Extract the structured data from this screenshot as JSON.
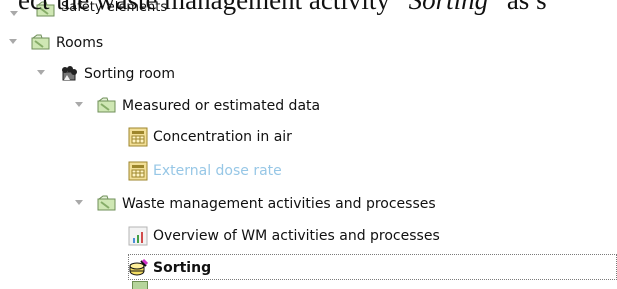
{
  "document": {
    "top_text_prefix": "ect the waste management activity “",
    "top_text_italic": "Sorting",
    "top_text_suffix": "” as s"
  },
  "tree": {
    "items": [
      {
        "label": "Safety elements"
      },
      {
        "label": "Rooms"
      },
      {
        "label": "Sorting room"
      },
      {
        "label": "Measured or estimated data"
      },
      {
        "label": "Concentration in air"
      },
      {
        "label": "External dose rate"
      },
      {
        "label": "Waste management activities and processes"
      },
      {
        "label": "Overview of WM activities and processes"
      },
      {
        "label": "Sorting"
      }
    ]
  },
  "icons": {
    "safety_elements": "folder-icon",
    "rooms": "folder-icon",
    "sorting_room": "room-icon",
    "measured_data": "folder-icon",
    "concentration": "table-icon",
    "external_dose": "table-icon",
    "wm_activities": "folder-icon",
    "overview": "chart-icon",
    "sorting": "process-icon"
  },
  "colors": {
    "disabled_text": "#97c7e6",
    "folder_green": "#cfe7b4",
    "folder_outline": "#6f8f59"
  }
}
